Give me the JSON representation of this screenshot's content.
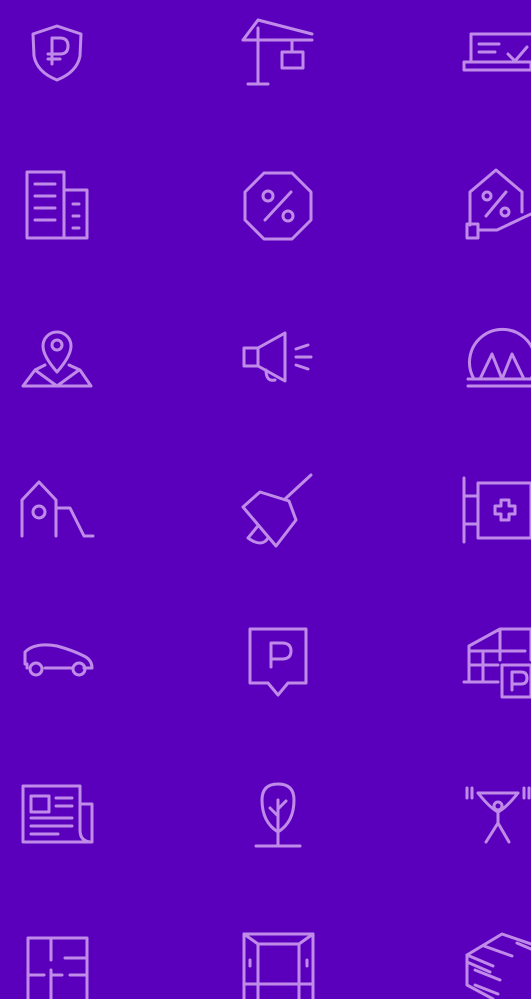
{
  "colors": {
    "background": "#5a00bd",
    "icon_stroke": "#c08be8"
  },
  "icons": [
    "ruble-shield-icon",
    "construction-crane-icon",
    "laptop-checklist-icon",
    "office-buildings-icon",
    "percent-badge-icon",
    "mortgage-house-percent-icon",
    "map-location-pin-icon",
    "megaphone-icon",
    "metro-station-icon",
    "playground-slide-icon",
    "school-bell-icon",
    "pharmacy-sign-icon",
    "car-icon",
    "parking-sign-icon",
    "parking-garage-icon",
    "newspaper-icon",
    "tree-park-icon",
    "weightlifting-gym-icon",
    "floor-plan-icon",
    "wardrobe-storage-icon",
    "warehouse-pantry-icon"
  ]
}
